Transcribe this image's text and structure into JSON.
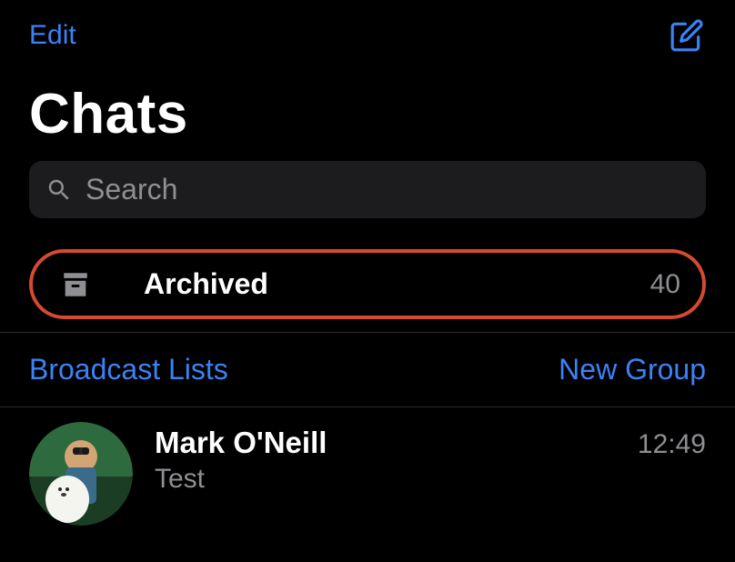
{
  "topBar": {
    "editLabel": "Edit"
  },
  "title": "Chats",
  "search": {
    "placeholder": "Search"
  },
  "archived": {
    "label": "Archived",
    "count": "40"
  },
  "actions": {
    "broadcastLists": "Broadcast Lists",
    "newGroup": "New Group"
  },
  "chats": [
    {
      "name": "Mark O'Neill",
      "time": "12:49",
      "message": "Test"
    }
  ]
}
